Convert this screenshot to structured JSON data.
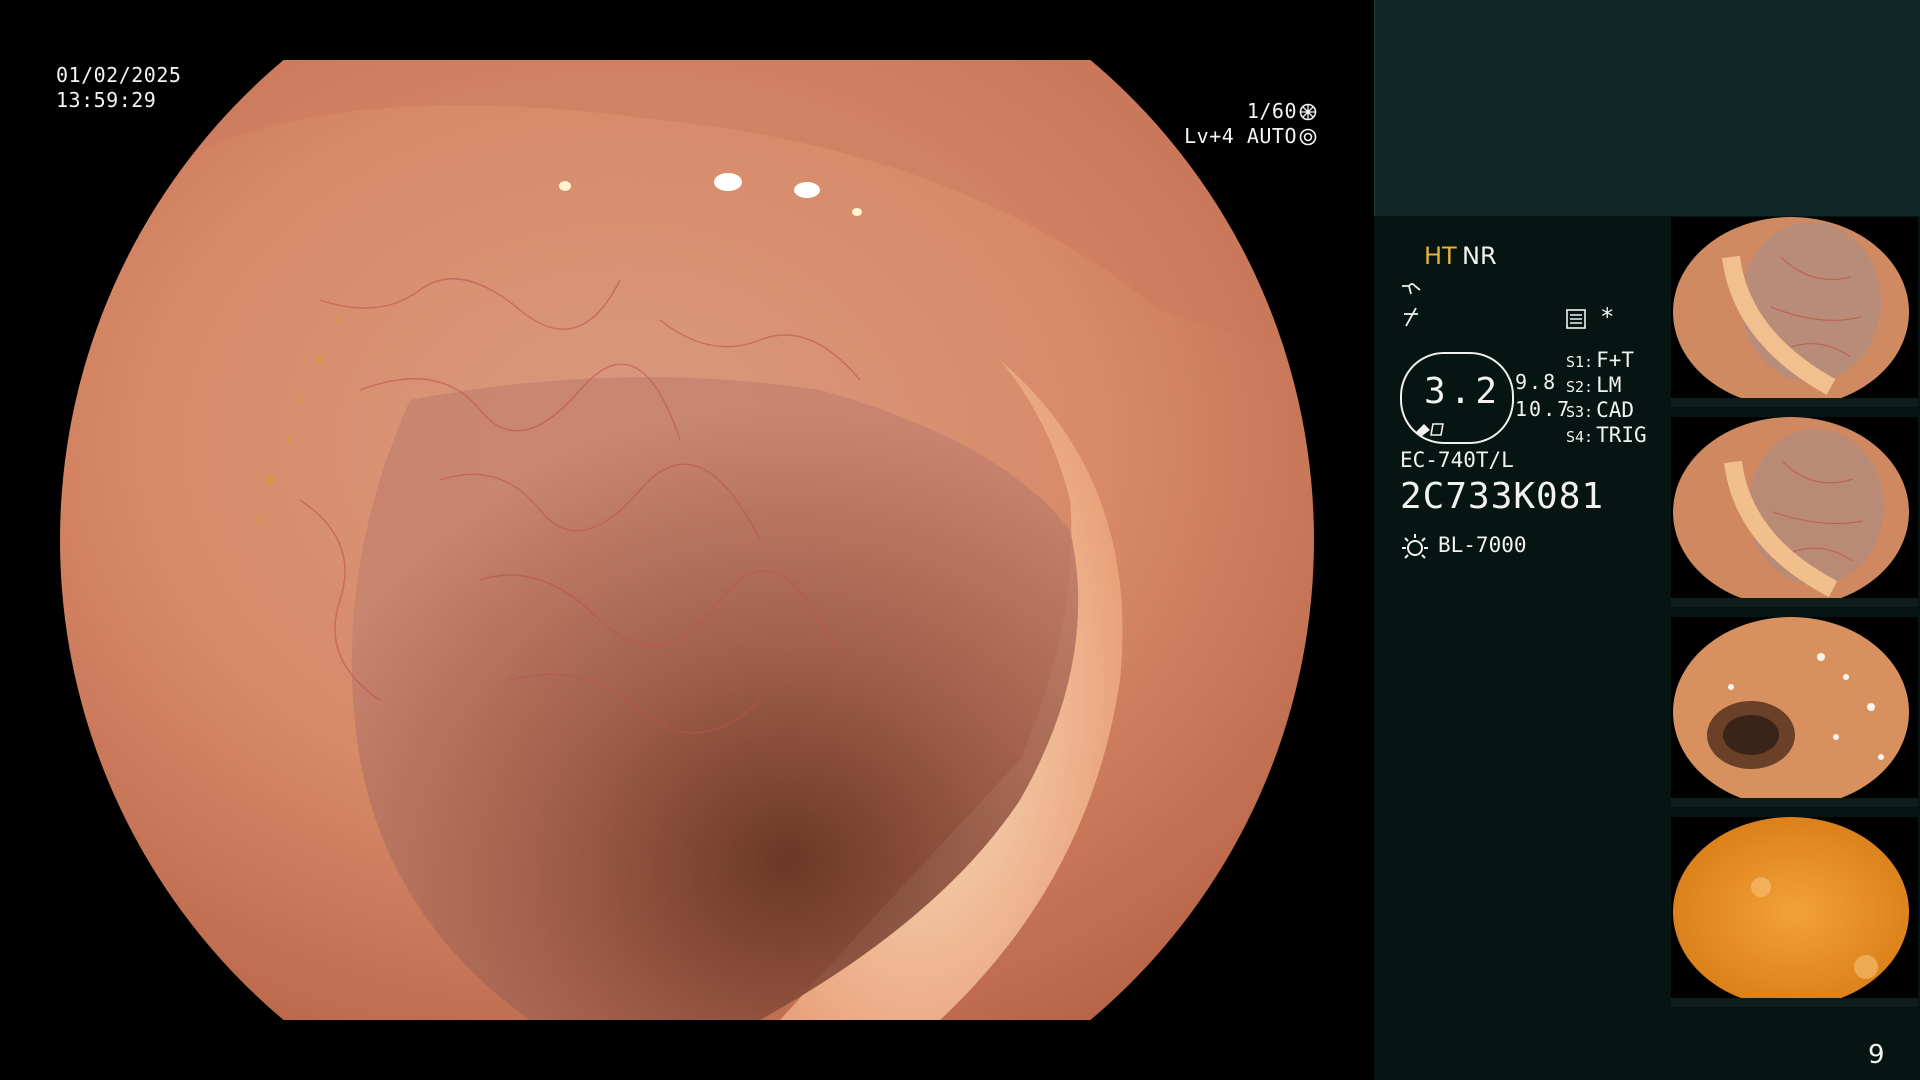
{
  "overlay": {
    "date": "01/02/2025",
    "time": "13:59:29",
    "shutter": "1/60",
    "level": "Lv+4",
    "mode": "AUTO"
  },
  "panel": {
    "ht": "HT",
    "nr": "NR",
    "star": "*",
    "oval_value": "3.2",
    "value_a": "9.8",
    "value_b": "10.7",
    "switches": [
      {
        "key": "S1:",
        "value": "F+T"
      },
      {
        "key": "S2:",
        "value": "LM"
      },
      {
        "key": "S3:",
        "value": "CAD"
      },
      {
        "key": "S4:",
        "value": "TRIG"
      }
    ],
    "scope_model": "EC-740T/L",
    "serial": "2C733K081",
    "light_source": "BL-7000",
    "page_number": "9"
  },
  "colors": {
    "panel_bg": "#061412",
    "panel_top_bg": "#0f2826",
    "ht_accent": "#e8b23a",
    "text": "#f2f2f2"
  },
  "icons": [
    "shutter-icon",
    "auto-iris-icon",
    "wave-icon",
    "flash-icon",
    "settings-icon",
    "sun-icon",
    "oval-indicator-icons"
  ],
  "thumbnails": [
    {
      "id": "thumb-1",
      "label": "captured-image-1"
    },
    {
      "id": "thumb-2",
      "label": "captured-image-2"
    },
    {
      "id": "thumb-3",
      "label": "captured-image-3"
    },
    {
      "id": "thumb-4",
      "label": "captured-image-4"
    }
  ]
}
